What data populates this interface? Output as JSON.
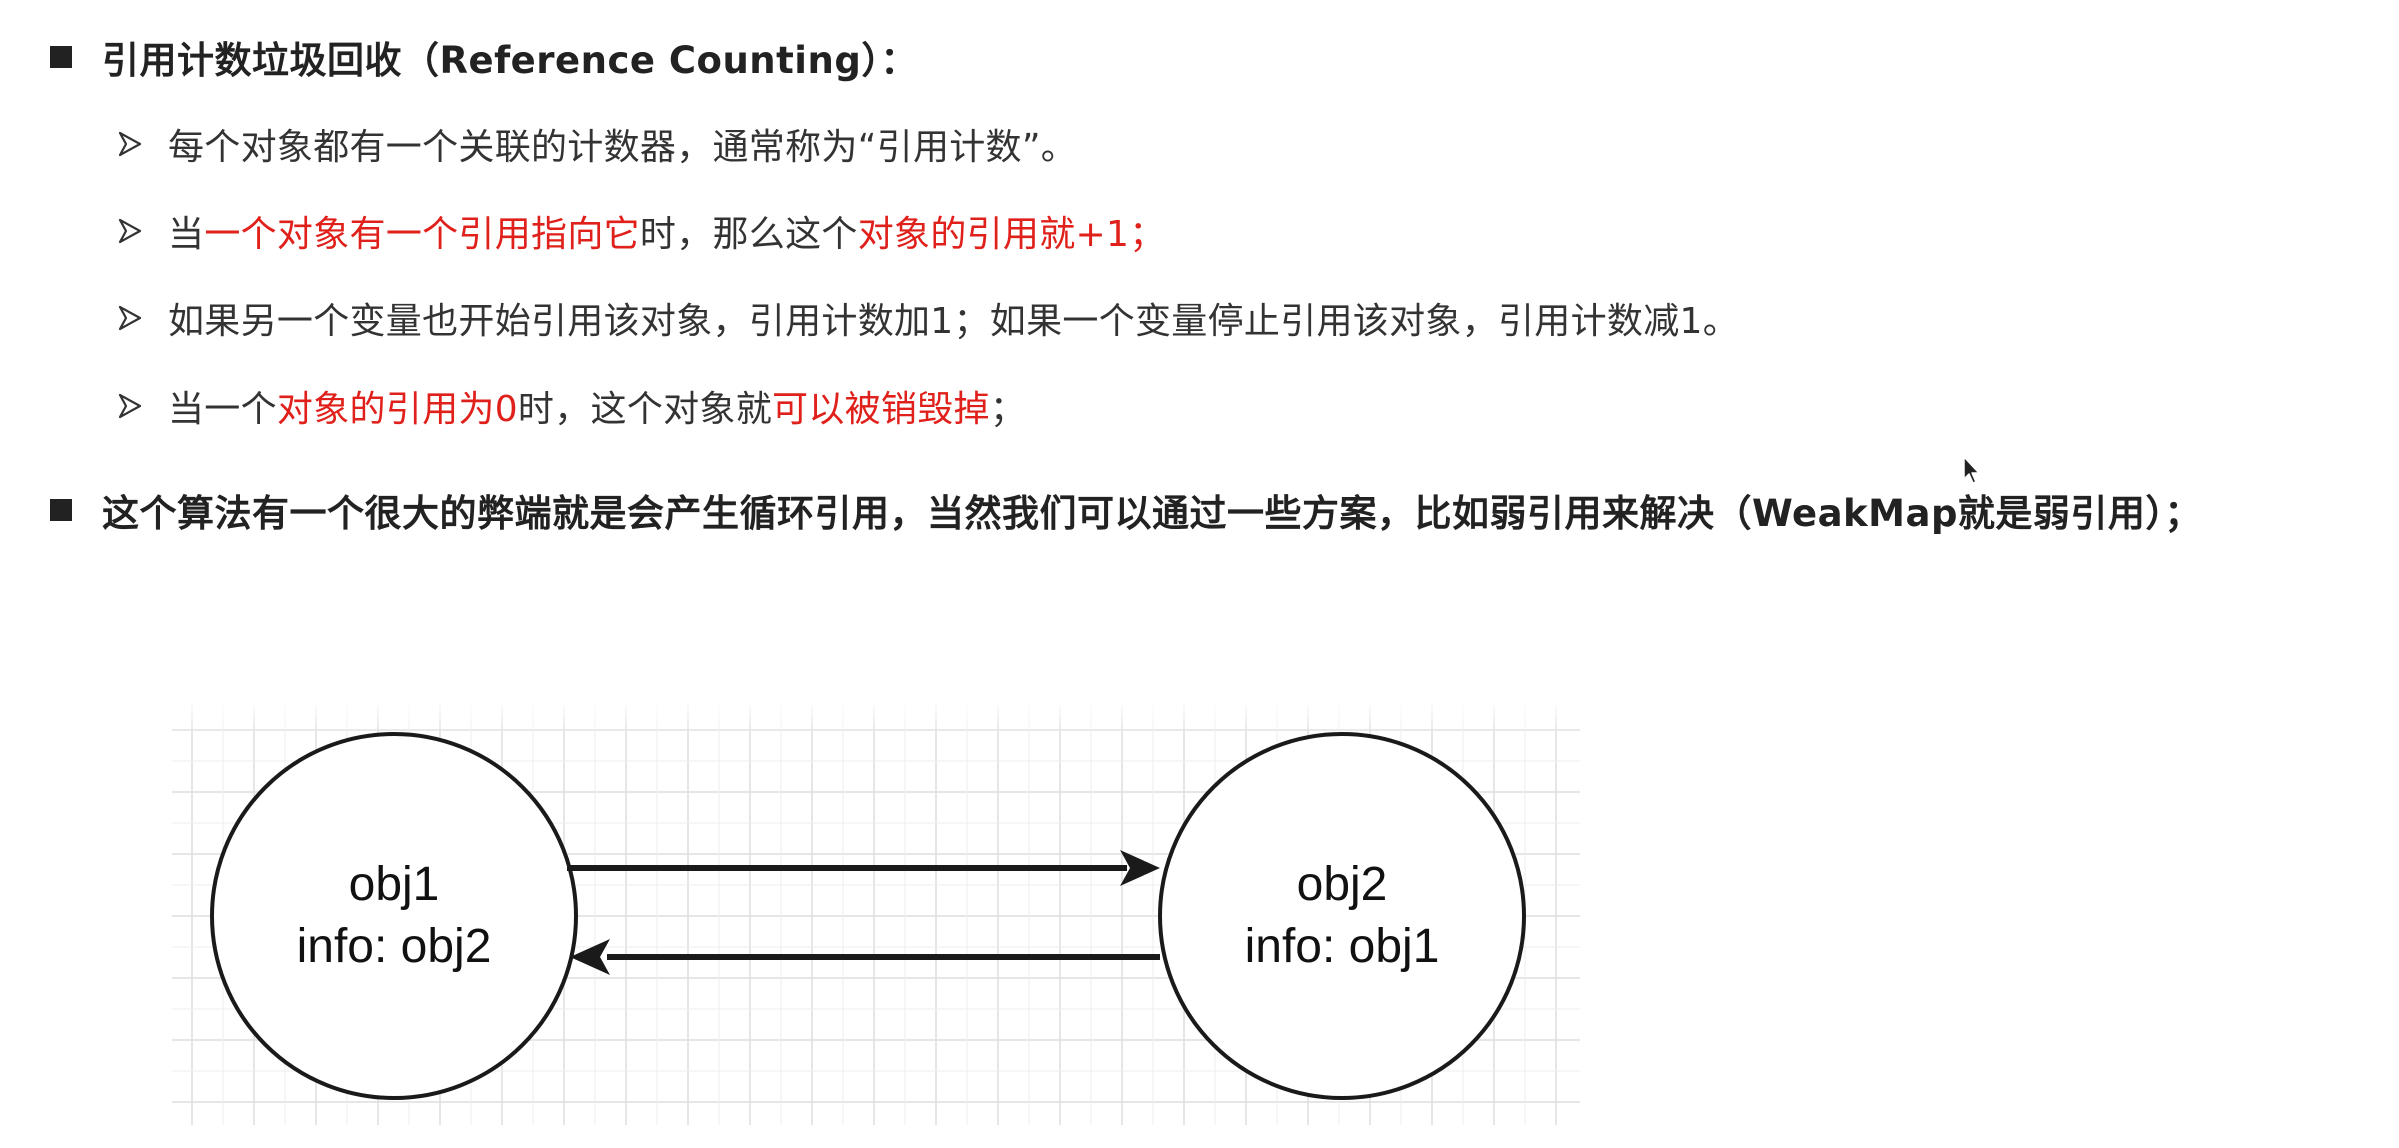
{
  "bullets": {
    "b1": {
      "text": "引用计数垃圾回收（Reference Counting）："
    },
    "b2": {
      "text": "这个算法有一个很大的弊端就是会产生循环引用，当然我们可以通过一些方案，比如弱引用来解决（WeakMap就是弱引用）；"
    }
  },
  "sub_items": [
    {
      "parts": [
        "每个对象都有一个关联的计数器，通常称为“引用计数”。"
      ]
    },
    {
      "parts": [
        "当",
        "一个对象有一个引用指向它",
        "时，那么这个",
        "对象的引用就+1；"
      ]
    },
    {
      "parts": [
        "如果另一个变量也开始引用该对象，引用计数加1；如果一个变量停止引用该对象，引用计数减1。"
      ]
    },
    {
      "parts": [
        "当一个",
        "对象的引用为0",
        "时，这个对象就",
        "可以被销毁掉",
        "；"
      ]
    }
  ],
  "diagram": {
    "node1": {
      "line1": "obj1",
      "line2": "info: obj2"
    },
    "node2": {
      "line1": "obj2",
      "line2": "info: obj1"
    }
  },
  "colors": {
    "highlight": "#e0201b",
    "text": "#333333",
    "grid": "#dcdcdc"
  },
  "icons": {
    "main_bullet": "square-bullet-icon",
    "sub_bullet": "arrow-bullet-icon",
    "cursor": "mouse-cursor-icon"
  }
}
